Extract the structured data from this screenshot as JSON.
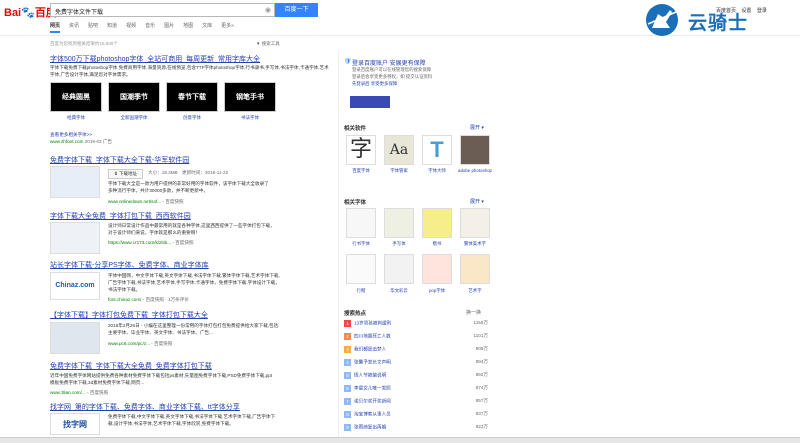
{
  "header": {
    "logo_text": "Bai",
    "logo_paw": "du",
    "logo_suffix": "百度",
    "query": "免费字体文件下载",
    "search_button": "百度一下",
    "top_links": [
      "百度首页",
      "设置",
      "登录"
    ],
    "watermark": "云骑士"
  },
  "tabs": [
    "网页",
    "资讯",
    "贴吧",
    "知道",
    "视频",
    "音乐",
    "图片",
    "地图",
    "文库",
    "更多»"
  ],
  "stats": "百度为您找到相关结果约16,600个",
  "search_tools": "搜索工具",
  "results": [
    {
      "title": "字体500万下载photoshop字体_全站可商用_每周更新_常用字库大全",
      "snippet": "字体下载免费下载photoshop字体,免费商用字体,海量资源,在线预览,包含TTF字体photoshop字体,行书隶书,手写体,书法字体,卡通字体,艺术字体,广告设计字体,满足您对字体需求。",
      "thumbs": [
        {
          "text": "经典圆黑",
          "label": "经典字体"
        },
        {
          "text": "国潮季节",
          "label": "全新国潮字体"
        },
        {
          "text": "春节下载",
          "label": "创意字体"
        },
        {
          "text": "钢笔手书",
          "label": "书法字体"
        }
      ],
      "extra": "查看更多相关字体>>",
      "url": "www.zhfont.com",
      "date": "2019-03",
      "tag": "广告"
    },
    {
      "title": "免费字体下载_字体下载大全下载-华军软件园",
      "download_label": "下载地址",
      "size_label": "大小：18.3MB",
      "time_label": "更新时间：2018-11-22",
      "snippet": "字体下载大全是一款为用户提供的非常好用的字体软件，该字体下载大全收录了多种流行字体，共计30000多款，并不断更新中。",
      "url": "www.onlinedown.net/sof...",
      "tag": "百度快照"
    },
    {
      "title": "字体下载大全免费_字体打包下载_西西软件园",
      "snippet": "设计师日常设计作品中最常用的就是各种字体,这里西西提供了一些字体打包下载，对于设计师们来说，字体就是那么的重要啊！",
      "url": "https://www.cr173.com/k/zitib...",
      "tag": "百度快照"
    },
    {
      "title": "站长字体下载-分享PS字体、免费字体、商业字体库",
      "snippet": "字体中国网，中文字体下载,英文字体下载,书法字体下载,繁体字体下载,艺术字体下载,广告字体下载,书法字体,艺术字体,手写字体,卡通字体，免费字体下载,字体设计下载，书法字体下载。",
      "url": "font.chinaz.com/",
      "logo": "Chinaz.com",
      "tag": "百度快照 · 1万条评价"
    },
    {
      "title": "【字体下载】字体打包免费下载_字体打包下载大全",
      "snippet": "2018年2月26日 - 小编在这里整理一份常用的字体打包打包免费提供给大家下载,包括:主要字体、毕业字体、英文字体、书法字体、广告...",
      "url": "www.pc6.com/pc/z...",
      "tag": "百度快照"
    },
    {
      "title": "免费字体下载_字体下载大全免费_免费字体打包下载",
      "snippet": "近年中国免费字体网站提供免费各种素材免费字体下载包括ps素材,矢量图免费字体下载,PSD免费字体下载,ppt模板免费字体下载,3d素材免费字体下载,网页...",
      "url": "www.3lian.com/...",
      "tag": "百度快照"
    },
    {
      "title": "找字网_第的字体下载、免费字体、商业字体下载、tt字体分享",
      "snippet": "免费字体下载,中文字体下载,英文字体下载,书法字体下载,艺术字体下载,广告字体下载,设计字体,书法字体,艺术字体下载,字体欣赏,免费字体下载。",
      "url": "www.zhaozi.cn/",
      "logo": "找字网",
      "tag": "百度快照"
    }
  ],
  "right_panel": {
    "login_title": "登录百度账户 安展更有保障",
    "login_lines": [
      "登录百度账户可以在线管理您的搜索保障",
      "登录后会享受更多特权，如 提交认证资料",
      "先登录后 享受更多保障"
    ],
    "related_software_title": "相关软件",
    "fold_label": "展开",
    "software": [
      {
        "label": "百度字体",
        "glyph": "字"
      },
      {
        "label": "字体管家",
        "glyph": "Aa"
      },
      {
        "label": "字体大师",
        "glyph": "T"
      },
      {
        "label": "adobe photoshop",
        "glyph": ""
      }
    ],
    "related_fonts_title": "相关字体",
    "fonts_row1": [
      "行书字体",
      "手写体",
      "楷书",
      "繁体美术字"
    ],
    "fonts_row2": [
      "行楷",
      "华文彩云",
      "pop字体",
      "艺术字"
    ],
    "hot_title": "搜索热点",
    "hot_switch": "换一换",
    "hot": [
      {
        "text": "13岁男孩被判缓刑",
        "count": "1156万"
      },
      {
        "text": "四川地震死亡人数",
        "count": "1101万"
      },
      {
        "text": "我们都是追梦人",
        "count": "908万"
      },
      {
        "text": "张馨予发长文声明",
        "count": "894万"
      },
      {
        "text": "情人节被骗说明",
        "count": "892万"
      },
      {
        "text": "李晨女儿唯一发照",
        "count": "874万"
      },
      {
        "text": "诺贝尔奖开奖新闻",
        "count": "857万"
      },
      {
        "text": "淘宝博客从事人员",
        "count": "837万"
      },
      {
        "text": "张雨绮复出再婚",
        "count": "823万"
      }
    ]
  },
  "colors": {
    "link": "#2440b3",
    "accent": "#3385ff",
    "url": "#008000",
    "hot1": "#f54545",
    "hot2": "#ff8547",
    "hot3": "#ffac38",
    "hot_rest": "#8eb9f5"
  }
}
